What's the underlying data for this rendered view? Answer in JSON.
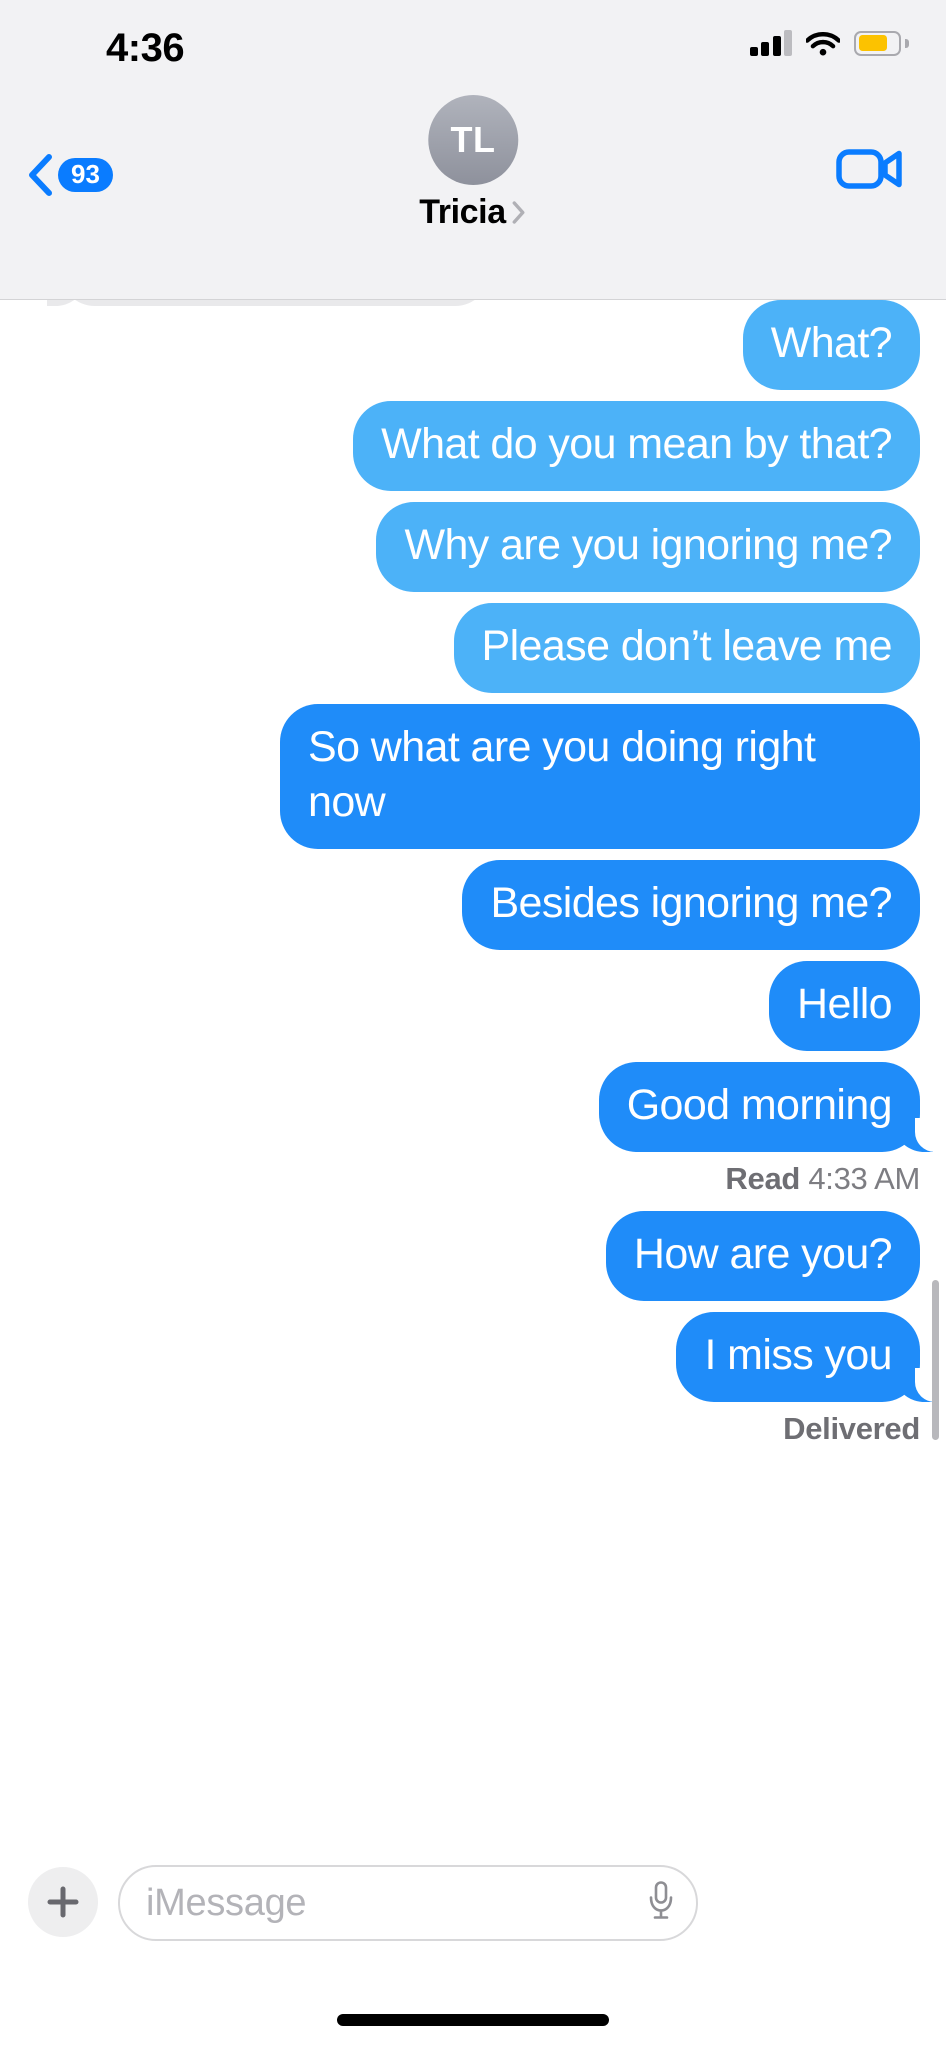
{
  "status_bar": {
    "time": "4:36",
    "signal_icon": "cellular-bars-icon",
    "wifi_icon": "wifi-icon",
    "battery_icon": "battery-low-power-icon",
    "battery_level_pct": 76,
    "battery_color": "#fcc200",
    "signal_bars_filled": 3,
    "signal_bars_total": 4
  },
  "nav_bar": {
    "back_icon": "chevron-left-icon",
    "back_badge": "93",
    "avatar_initials": "TL",
    "contact_name": "Tricia",
    "name_chevron_icon": "chevron-right-icon",
    "facetime_icon": "video-camera-icon",
    "accent_color": "#0a7cff",
    "bar_background": "#f2f2f4"
  },
  "conversation": {
    "messages": [
      {
        "text": "What?",
        "side": "sent",
        "style": "sms",
        "tail": false
      },
      {
        "text": "What do you mean by that?",
        "side": "sent",
        "style": "sms",
        "tail": false
      },
      {
        "text": "Why are you ignoring me?",
        "side": "sent",
        "style": "sms",
        "tail": false
      },
      {
        "text": "Please don’t leave me",
        "side": "sent",
        "style": "sms",
        "tail": false
      },
      {
        "text": "So what are you doing right now",
        "side": "sent",
        "style": "blue",
        "tail": false
      },
      {
        "text": "Besides ignoring me?",
        "side": "sent",
        "style": "blue",
        "tail": false
      },
      {
        "text": "Hello",
        "side": "sent",
        "style": "blue",
        "tail": false
      },
      {
        "text": "Good morning",
        "side": "sent",
        "style": "blue",
        "tail": true
      }
    ],
    "read_receipt": {
      "label": "Read",
      "time": "4:33 AM"
    },
    "messages_after": [
      {
        "text": "How are you?",
        "side": "sent",
        "style": "blue",
        "tail": false
      },
      {
        "text": "I miss you",
        "side": "sent",
        "style": "blue",
        "tail": true
      }
    ],
    "delivered_receipt": {
      "label": "Delivered"
    },
    "bubble_sms_color": "#4cb2f8",
    "bubble_blue_color": "#1f8cf9",
    "received_bubble_color": "#e9e9eb"
  },
  "input_bar": {
    "plus_icon": "plus-icon",
    "placeholder": "iMessage",
    "mic_icon": "microphone-icon"
  }
}
